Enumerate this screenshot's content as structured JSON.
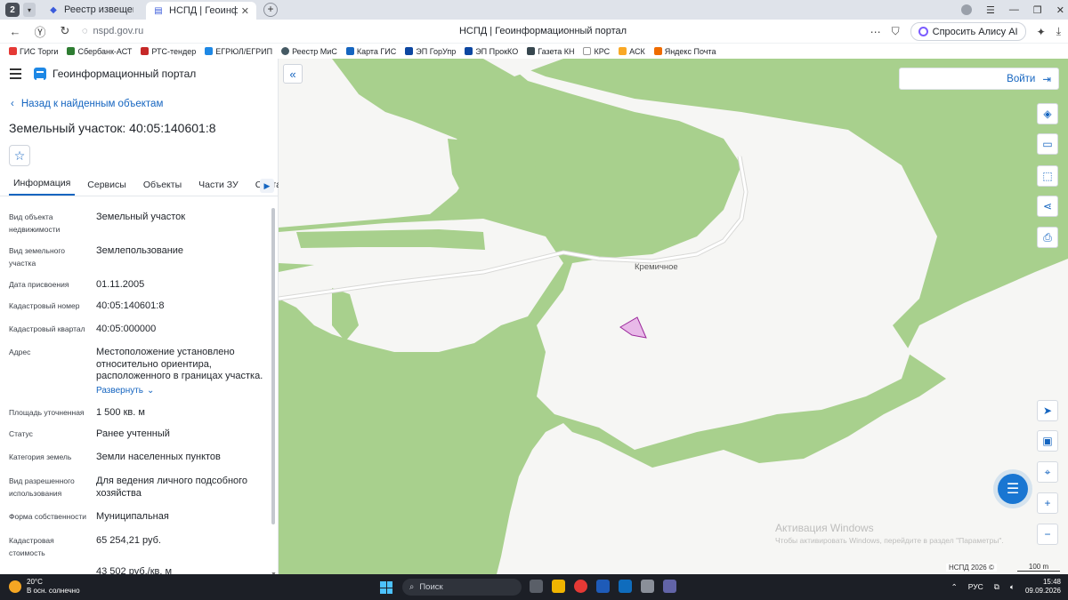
{
  "browser": {
    "tab_counter": "2",
    "tabs": [
      {
        "title": "Реестр извещений",
        "active": false
      },
      {
        "title": "НСПД | Геоинформацио",
        "active": true
      }
    ],
    "url": "nspd.gov.ru",
    "page_title": "НСПД | Геоинформационный портал",
    "alice_label": "Спросить Алису AI",
    "bookmarks": [
      "ГИС Торги",
      "Сбербанк-АСТ",
      "РТС-тендер",
      "ЕГРЮЛ/ЕГРИП",
      "Реестр МиС",
      "Карта ГИС",
      "ЭП ГорУпр",
      "ЭП ПрокКО",
      "Газета КН",
      "КРС",
      "АСК",
      "Яндекс Почта"
    ]
  },
  "app": {
    "title": "Геоинформационный портал",
    "back_label": "Назад к найденным объектам",
    "object_title": "Земельный участок: 40:05:140601:8",
    "tabs": [
      "Информация",
      "Сервисы",
      "Объекты",
      "Части ЗУ",
      "Состав"
    ],
    "fields": [
      {
        "label": "Вид объекта недвижимости",
        "value": "Земельный участок"
      },
      {
        "label": "Вид земельного участка",
        "value": "Землепользование"
      },
      {
        "label": "Дата присвоения",
        "value": "01.11.2005"
      },
      {
        "label": "Кадастровый номер",
        "value": "40:05:140601:8"
      },
      {
        "label": "Кадастровый квартал",
        "value": "40:05:000000"
      },
      {
        "label": "Адрес",
        "value": "Местоположение установлено относительно ориентира, расположенного в границах участка."
      },
      {
        "label": "Площадь уточненная",
        "value": "1 500 кв. м"
      },
      {
        "label": "Статус",
        "value": "Ранее учтенный"
      },
      {
        "label": "Категория земель",
        "value": "Земли населенных пунктов"
      },
      {
        "label": "Вид разрешенного использования",
        "value": "Для ведения личного подсобного хозяйства"
      },
      {
        "label": "Форма собственности",
        "value": "Муниципальная"
      },
      {
        "label": "Кадастровая стоимость",
        "value": "65 254,21 руб."
      },
      {
        "label": "",
        "value": "43 502 руб./кв. м"
      }
    ],
    "expand_label": "Развернуть"
  },
  "map": {
    "login_label": "Войти",
    "place_label": "Кремичное",
    "watermark_title": "Активация Windows",
    "watermark_text": "Чтобы активировать Windows, перейдите в раздел \"Параметры\".",
    "copyright": "НСПД 2026 ©",
    "scale_label": "100 m",
    "colors": {
      "forest": "#a8d08d",
      "land": "#f6f6f4",
      "parcel_fill": "#e8b9e8",
      "parcel_stroke": "#9c2a9c",
      "accent": "#1565c0"
    }
  },
  "taskbar": {
    "temperature": "20°C",
    "weather_text": "В осн. солнечно",
    "search_placeholder": "Поиск",
    "language": "РУС",
    "time": "15:48",
    "date": "09.09.2026"
  }
}
